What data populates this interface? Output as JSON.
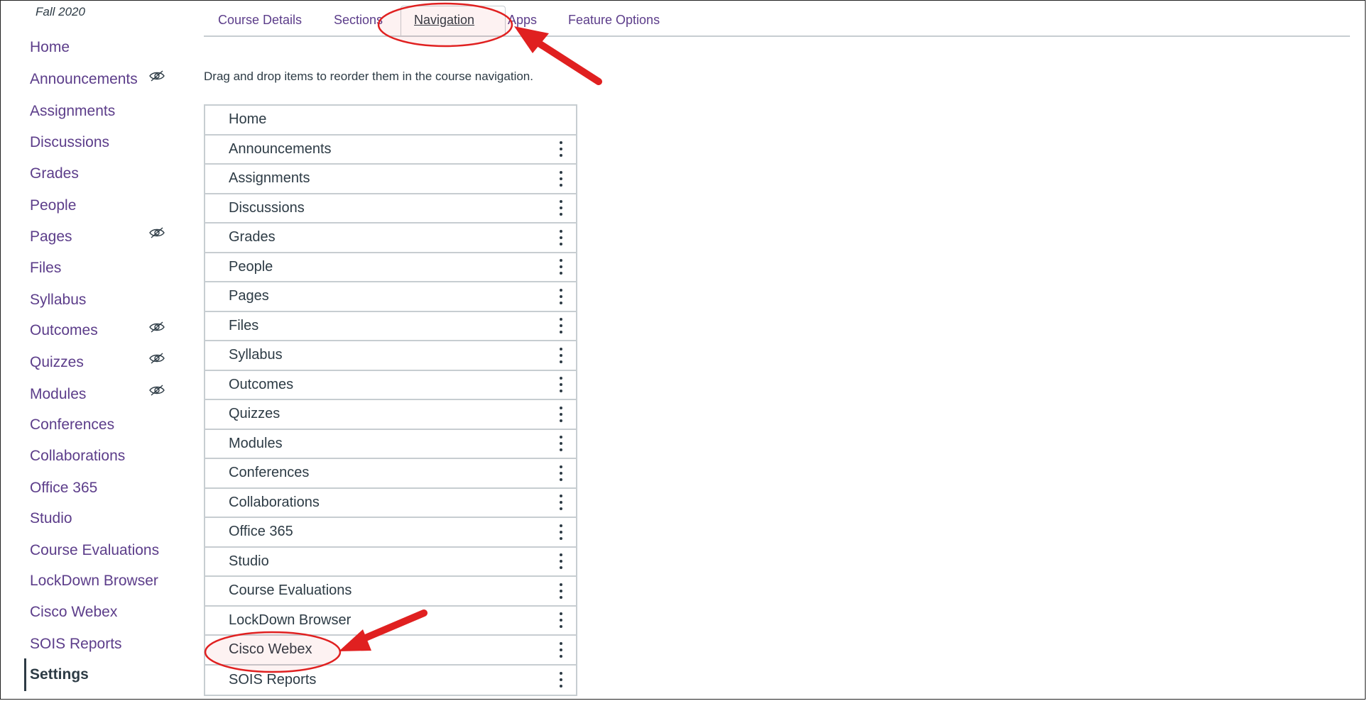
{
  "term": "Fall 2020",
  "sidebar": {
    "items": [
      {
        "label": "Home",
        "hidden": false
      },
      {
        "label": "Announcements",
        "hidden": true
      },
      {
        "label": "Assignments",
        "hidden": false
      },
      {
        "label": "Discussions",
        "hidden": false
      },
      {
        "label": "Grades",
        "hidden": false
      },
      {
        "label": "People",
        "hidden": false
      },
      {
        "label": "Pages",
        "hidden": true
      },
      {
        "label": "Files",
        "hidden": false
      },
      {
        "label": "Syllabus",
        "hidden": false
      },
      {
        "label": "Outcomes",
        "hidden": true
      },
      {
        "label": "Quizzes",
        "hidden": true
      },
      {
        "label": "Modules",
        "hidden": true
      },
      {
        "label": "Conferences",
        "hidden": false
      },
      {
        "label": "Collaborations",
        "hidden": false
      },
      {
        "label": "Office 365",
        "hidden": false
      },
      {
        "label": "Studio",
        "hidden": false
      },
      {
        "label": "Course Evaluations",
        "hidden": false
      },
      {
        "label": "LockDown Browser",
        "hidden": false
      },
      {
        "label": "Cisco Webex",
        "hidden": false
      },
      {
        "label": "SOIS Reports",
        "hidden": false
      },
      {
        "label": "Settings",
        "hidden": false
      }
    ]
  },
  "tabs": [
    {
      "label": "Course Details"
    },
    {
      "label": "Sections"
    },
    {
      "label": "Navigation"
    },
    {
      "label": "Apps"
    },
    {
      "label": "Feature Options"
    }
  ],
  "instructions": "Drag and drop items to reorder them in the course navigation.",
  "nav_list": [
    {
      "label": "Home"
    },
    {
      "label": "Announcements"
    },
    {
      "label": "Assignments"
    },
    {
      "label": "Discussions"
    },
    {
      "label": "Grades"
    },
    {
      "label": "People"
    },
    {
      "label": "Pages"
    },
    {
      "label": "Files"
    },
    {
      "label": "Syllabus"
    },
    {
      "label": "Outcomes"
    },
    {
      "label": "Quizzes"
    },
    {
      "label": "Modules"
    },
    {
      "label": "Conferences"
    },
    {
      "label": "Collaborations"
    },
    {
      "label": "Office 365"
    },
    {
      "label": "Studio"
    },
    {
      "label": "Course Evaluations"
    },
    {
      "label": "LockDown Browser"
    },
    {
      "label": "Cisco Webex"
    },
    {
      "label": "SOIS Reports"
    }
  ],
  "colors": {
    "link": "#5c3d8a",
    "text": "#2d3b45",
    "border": "#c7cdd1",
    "annotation": "#e02020"
  },
  "icons": {
    "hidden": "eye-slash-icon",
    "menu": "kebab-menu-icon"
  }
}
